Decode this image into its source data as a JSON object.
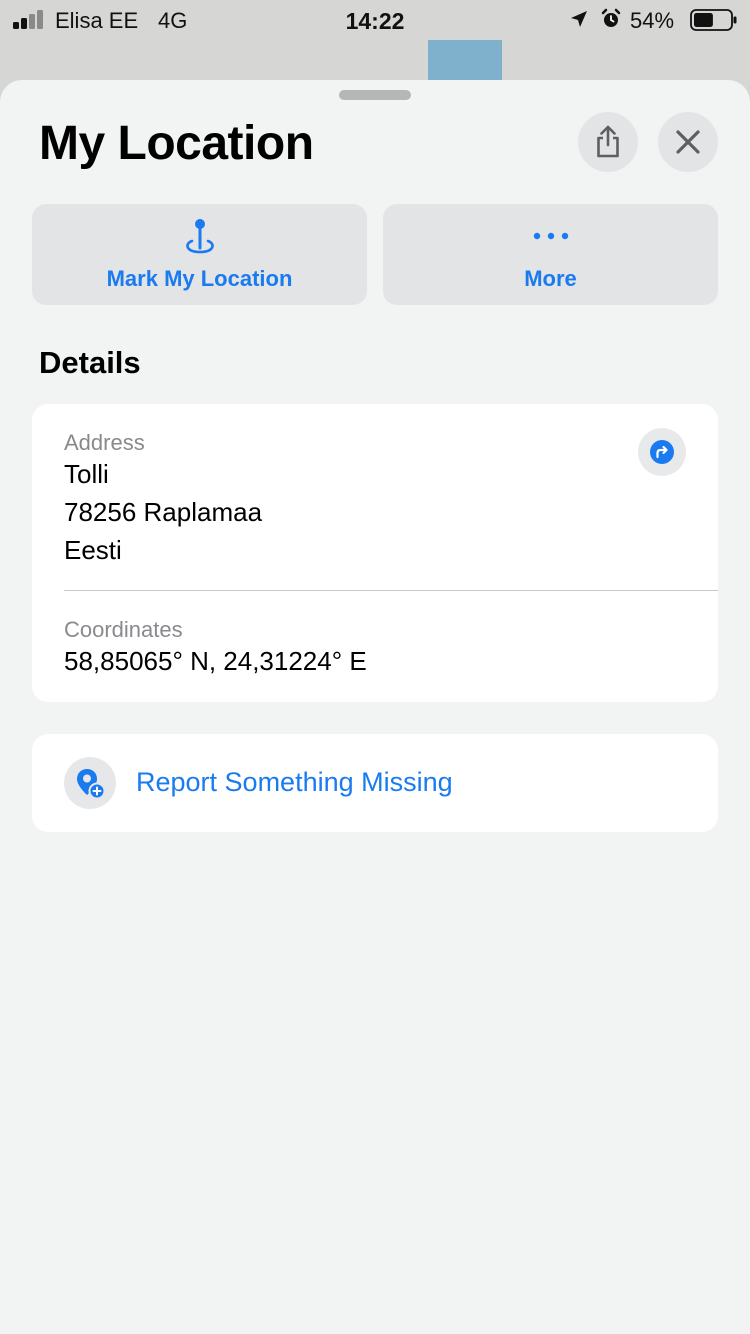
{
  "status_bar": {
    "carrier": "Elisa EE",
    "network": "4G",
    "time": "14:22",
    "battery": "54%",
    "battery_level": 0.54,
    "icons": [
      "signal-icon",
      "location-arrow-icon",
      "alarm-icon",
      "battery-icon"
    ]
  },
  "sheet": {
    "title": "My Location",
    "share_icon": "share-icon",
    "close_icon": "close-icon"
  },
  "actions": {
    "mark_label": "Mark My Location",
    "mark_icon": "pin-icon",
    "more_label": "More",
    "more_icon": "ellipsis-icon"
  },
  "details": {
    "title": "Details",
    "address_label": "Address",
    "address_lines": [
      "Tolli",
      "78256 Raplamaa",
      "Eesti"
    ],
    "directions_icon": "directions-icon",
    "coordinates_label": "Coordinates",
    "coordinates": "58,85065° N, 24,31224° E"
  },
  "report": {
    "label": "Report Something Missing",
    "icon": "add-place-icon"
  },
  "colors": {
    "accent": "#1a7bf0",
    "sheet_background": "#f2f3f3",
    "card_background": "#ffffff",
    "secondary_text": "#8a8a8e"
  }
}
